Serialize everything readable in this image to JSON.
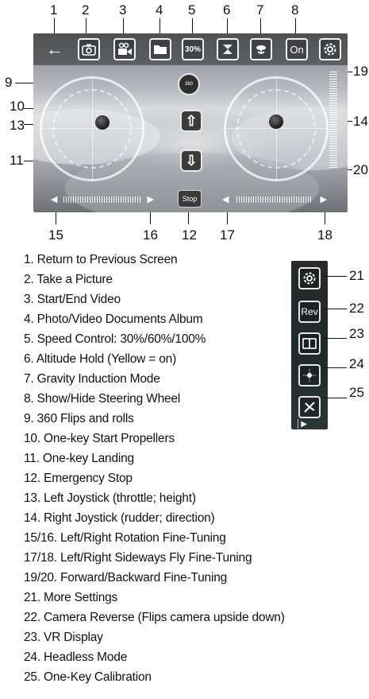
{
  "callouts": {
    "n1": "1",
    "n2": "2",
    "n3": "3",
    "n4": "4",
    "n5": "5",
    "n6": "6",
    "n7": "7",
    "n8": "8",
    "n9": "9",
    "n10": "10",
    "n11": "11",
    "n12": "12",
    "n13": "13",
    "n14": "14",
    "n15": "15",
    "n16": "16",
    "n17": "17",
    "n18": "18",
    "n19": "19",
    "n20": "20",
    "n21": "21",
    "n22": "22",
    "n23": "23",
    "n24": "24",
    "n25": "25"
  },
  "screen": {
    "speed_label": "30%",
    "steering_label": "On",
    "stop_label": "Stop",
    "flip_label": "360"
  },
  "side_panel": {
    "rev_label": "Rev"
  },
  "legend": [
    "1. Return to Previous Screen",
    "2. Take a Picture",
    "3. Start/End Video",
    "4. Photo/Video Documents Album",
    "5. Speed Control: 30%/60%/100%",
    "6. Altitude Hold (Yellow = on)",
    "7. Gravity Induction Mode",
    "8. Show/Hide Steering Wheel",
    "9. 360 Flips and rolls",
    "10. One-key Start Propellers",
    "11. One-key Landing",
    "12. Emergency Stop",
    "13. Left Joystick (throttle; height)",
    "14. Right Joystick (rudder; direction)",
    "15/16. Left/Right Rotation Fine-Tuning",
    "17/18. Left/Right Sideways Fly Fine-Tuning",
    "19/20. Forward/Backward Fine-Tuning",
    "21. More Settings",
    "22. Camera Reverse (Flips camera upside down)",
    "23. VR Display",
    "24. Headless Mode",
    "25. One-Key Calibration"
  ]
}
